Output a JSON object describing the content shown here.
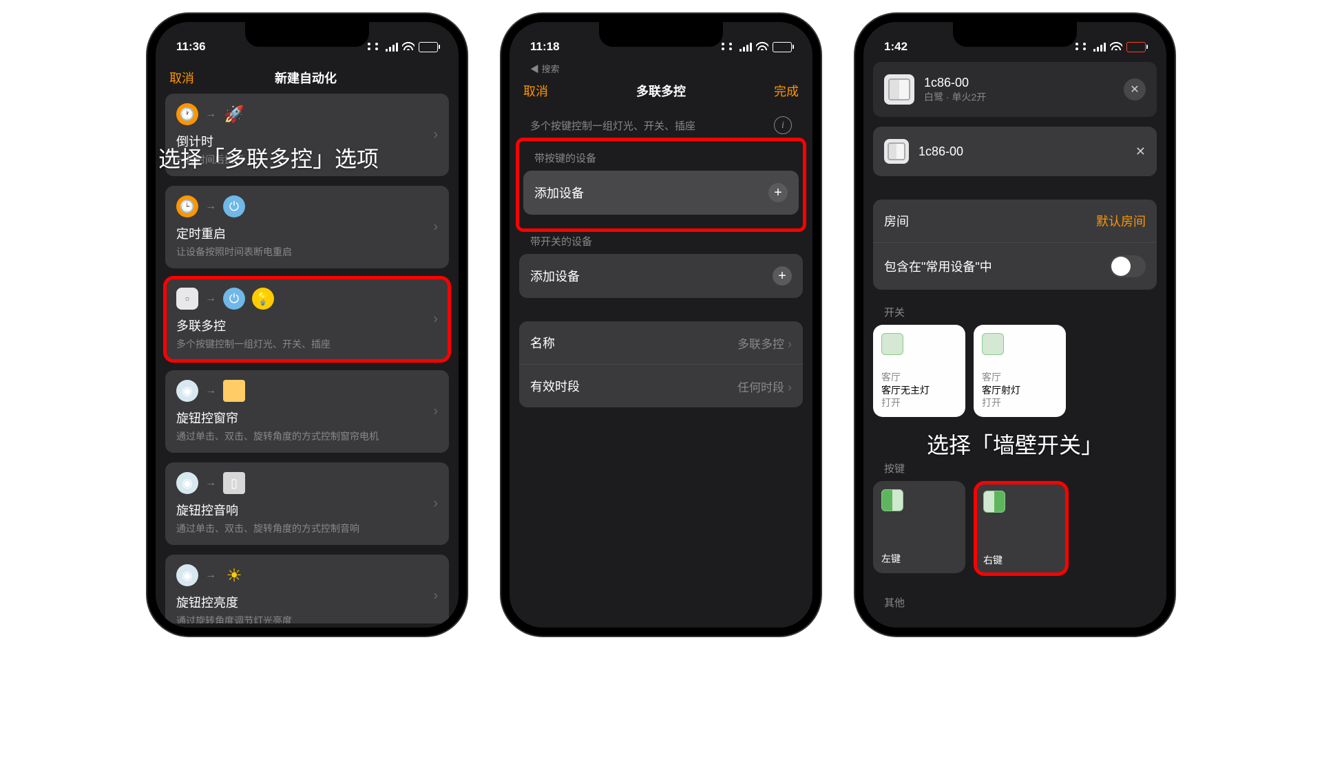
{
  "phone1": {
    "time": "11:36",
    "nav": {
      "cancel": "取消",
      "title": "新建自动化"
    },
    "overlay": "选择「多联多控」选项",
    "cards": [
      {
        "title": "倒计时",
        "sub": "一段时间后执行"
      },
      {
        "title": "定时重启",
        "sub": "让设备按照时间表断电重启"
      },
      {
        "title": "多联多控",
        "sub": "多个按键控制一组灯光、开关、插座"
      },
      {
        "title": "旋钮控窗帘",
        "sub": "通过单击、双击、旋转角度的方式控制窗帘电机"
      },
      {
        "title": "旋钮控音响",
        "sub": "通过单击、双击、旋转角度的方式控制音响"
      },
      {
        "title": "旋钮控亮度",
        "sub": "通过旋转角度调节灯光亮度"
      }
    ]
  },
  "phone2": {
    "time": "11:18",
    "back": "◀ 搜索",
    "nav": {
      "cancel": "取消",
      "title": "多联多控",
      "done": "完成"
    },
    "subtitle": "多个按键控制一组灯光、开关、插座",
    "section1": "带按键的设备",
    "add_device": "添加设备",
    "section2": "带开关的设备",
    "name_label": "名称",
    "name_value": "多联多控",
    "period_label": "有效时段",
    "period_value": "任何时段"
  },
  "phone3": {
    "time": "1:42",
    "device": {
      "name": "1c86-00",
      "sub": "白鹭 · 单火2开"
    },
    "device_row": "1c86-00",
    "room_label": "房间",
    "room_value": "默认房间",
    "common_label": "包含在\"常用设备\"中",
    "switch_label": "开关",
    "tiles": [
      {
        "room": "客厅",
        "name": "客厅无主灯",
        "state": "打开"
      },
      {
        "room": "客厅",
        "name": "客厅射灯",
        "state": "打开"
      }
    ],
    "overlay": "选择「墙壁开关」",
    "keys_label": "按键",
    "keys": [
      "左键",
      "右键"
    ],
    "other": "其他"
  }
}
